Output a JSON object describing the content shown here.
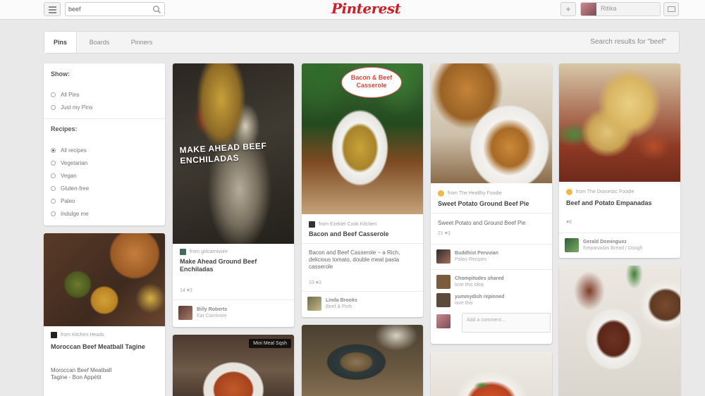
{
  "header": {
    "search_value": "beef",
    "logo_text": "Pinterest",
    "add_label": "+",
    "user_name": "Ritika"
  },
  "tabs": {
    "items": [
      "Pins",
      "Boards",
      "Pinners"
    ],
    "results_text": "Search results for \"beef\""
  },
  "filters": {
    "show_heading": "Show:",
    "show_options": [
      "All Pins",
      "Just my Pins"
    ],
    "recipes_heading": "Recipes:",
    "recipe_options": [
      "All recipes",
      "Vegetarian",
      "Vegan",
      "Gluten-free",
      "Paleo",
      "Indulge me"
    ],
    "selected_recipe": "All recipes"
  },
  "pins": {
    "enchiladas": {
      "overlay": "MAKE AHEAD BEEF ENCHILADAS",
      "source": "from girlcarnivore",
      "title": "Make Ahead Ground Beef Enchiladas",
      "stats": "14  ♥3",
      "pinner_name": "Billy Roberts",
      "pinner_board": "Eat Carnivore"
    },
    "casserole": {
      "overlay": "Bacon & Beef Casserole",
      "source": "from Ezekiel Cook Kitchen",
      "title": "Bacon and Beef Casserole",
      "desc": "Bacon and Beef Casserole ~ a Rich, delicious tomato, double meat pasta casserole",
      "stats": "33  ♥3",
      "pinner_name": "Linda Brooks",
      "pinner_board": "Beef & Pork"
    },
    "sweet_potato": {
      "source": "from The Healthy Foodie",
      "title": "Sweet Potato Ground Beef Pie",
      "desc": "Sweet Potato and Ground Beef Pie",
      "stats": "21  ♥3",
      "pinner_name": "Buddhist Peruvian",
      "pinner_board": "Paleo Recipes",
      "comment1_name": "Chompitudes shared",
      "comment1_text": "love this idea",
      "comment2_name": "yummydish repinned",
      "comment2_text": "love this",
      "comment_placeholder": "Add a comment..."
    },
    "empanadas": {
      "source": "from The Domestic Foodie",
      "title": "Beef and Potato Empanadas",
      "stats": "♥8",
      "pinner_name": "Gerald Dominguez",
      "pinner_board": "Empanadas Bread / Dough"
    },
    "tagine": {
      "source": "from Kitchen Heads",
      "title": "Moroccan Beef Meatball Tagine",
      "desc": "Moroccan Beef Meatball Tagine - Bon Appétit"
    },
    "soup": {
      "tag": "Mini Meal Sqsh"
    }
  }
}
